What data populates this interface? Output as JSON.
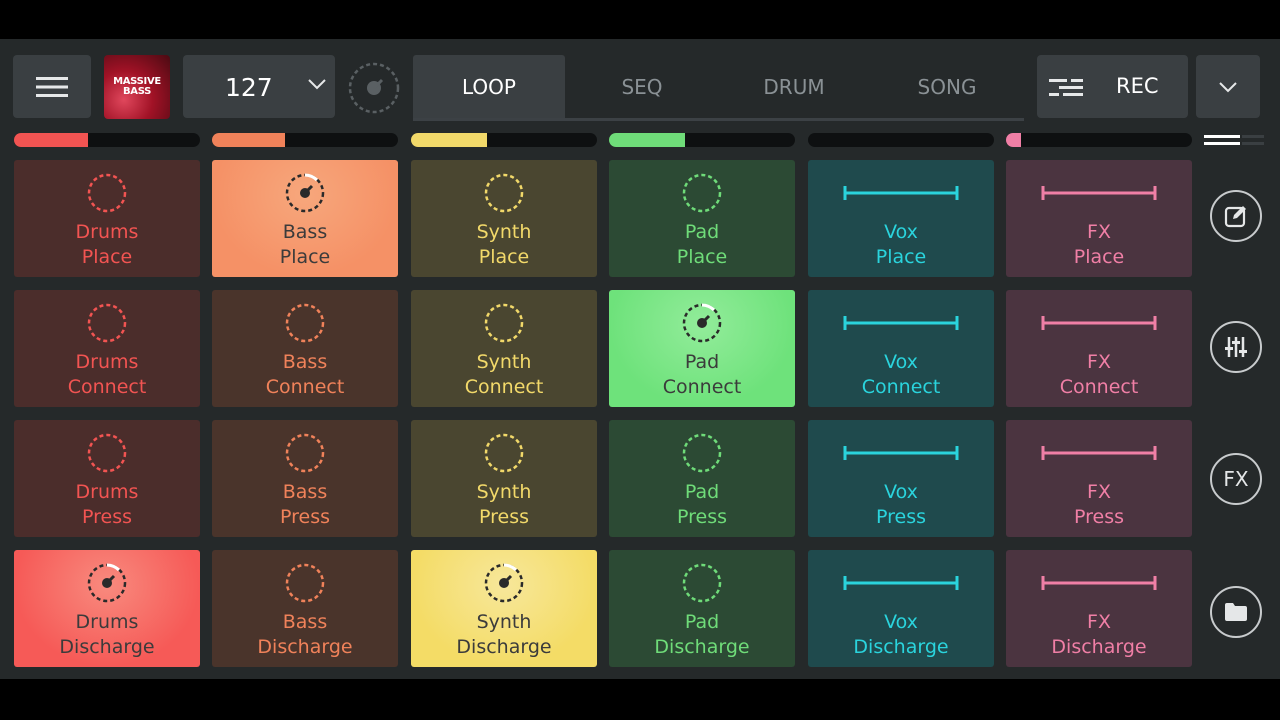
{
  "topbar": {
    "menu_icon": "hamburger-icon",
    "album_line1": "MASSIVE",
    "album_line2": "BASS",
    "bpm": "127",
    "tabs": [
      "LOOP",
      "SEQ",
      "DRUM",
      "SONG"
    ],
    "active_tab": "LOOP",
    "rec_label": "REC"
  },
  "levels": [
    {
      "color": "#f25452",
      "level": 0.4
    },
    {
      "color": "#f0825a",
      "level": 0.39
    },
    {
      "color": "#f2d96a",
      "level": 0.41
    },
    {
      "color": "#6fdc79",
      "level": 0.41
    },
    {
      "color": "#2ad4dd",
      "level": 0.0
    },
    {
      "color": "#f07fa6",
      "level": 0.08
    }
  ],
  "columns": [
    {
      "name": "Drums",
      "icon": "dashed-circle-icon",
      "color": "#f25452",
      "bg": "#4b2d2b"
    },
    {
      "name": "Bass",
      "icon": "dashed-circle-icon",
      "color": "#f0825a",
      "bg": "#4a342b"
    },
    {
      "name": "Synth",
      "icon": "dashed-circle-icon",
      "color": "#f2d96a",
      "bg": "#4a4630"
    },
    {
      "name": "Pad",
      "icon": "dashed-circle-icon",
      "color": "#6fdc79",
      "bg": "#2c4a34"
    },
    {
      "name": "Vox",
      "icon": "line-segment-icon",
      "color": "#2ad4dd",
      "bg": "#1f4a4d"
    },
    {
      "name": "FX",
      "icon": "line-segment-icon",
      "color": "#f07fa6",
      "bg": "#4b3440"
    }
  ],
  "rows": [
    "Place",
    "Connect",
    "Press",
    "Discharge"
  ],
  "pads": [
    [
      {
        "l1": "Drums",
        "l2": "Place",
        "active": false
      },
      {
        "l1": "Bass",
        "l2": "Place",
        "active": true,
        "activeBg": "#f59166",
        "activeTop": "#f7a77c"
      },
      {
        "l1": "Synth",
        "l2": "Place",
        "active": false
      },
      {
        "l1": "Pad",
        "l2": "Place",
        "active": false
      },
      {
        "l1": "Vox",
        "l2": "Place",
        "active": false
      },
      {
        "l1": "FX",
        "l2": "Place",
        "active": false
      }
    ],
    [
      {
        "l1": "Drums",
        "l2": "Connect",
        "active": false
      },
      {
        "l1": "Bass",
        "l2": "Connect",
        "active": false
      },
      {
        "l1": "Synth",
        "l2": "Connect",
        "active": false
      },
      {
        "l1": "Pad",
        "l2": "Connect",
        "active": true,
        "activeBg": "#6ee27b",
        "activeTop": "#92ec9a"
      },
      {
        "l1": "Vox",
        "l2": "Connect",
        "active": false
      },
      {
        "l1": "FX",
        "l2": "Connect",
        "active": false
      }
    ],
    [
      {
        "l1": "Drums",
        "l2": "Press",
        "active": false
      },
      {
        "l1": "Bass",
        "l2": "Press",
        "active": false
      },
      {
        "l1": "Synth",
        "l2": "Press",
        "active": false
      },
      {
        "l1": "Pad",
        "l2": "Press",
        "active": false
      },
      {
        "l1": "Vox",
        "l2": "Press",
        "active": false
      },
      {
        "l1": "FX",
        "l2": "Press",
        "active": false
      }
    ],
    [
      {
        "l1": "Drums",
        "l2": "Discharge",
        "active": true,
        "activeBg": "#f65a57",
        "activeTop": "#f88a7e"
      },
      {
        "l1": "Bass",
        "l2": "Discharge",
        "active": false
      },
      {
        "l1": "Synth",
        "l2": "Discharge",
        "active": true,
        "activeBg": "#f4dc66",
        "activeTop": "#f7e79a"
      },
      {
        "l1": "Pad",
        "l2": "Discharge",
        "active": false
      },
      {
        "l1": "Vox",
        "l2": "Discharge",
        "active": false
      },
      {
        "l1": "FX",
        "l2": "Discharge",
        "active": false
      }
    ]
  ],
  "sidebar": {
    "buttons": [
      "edit-icon",
      "mixer-icon",
      "FX",
      "folder-icon"
    ]
  }
}
